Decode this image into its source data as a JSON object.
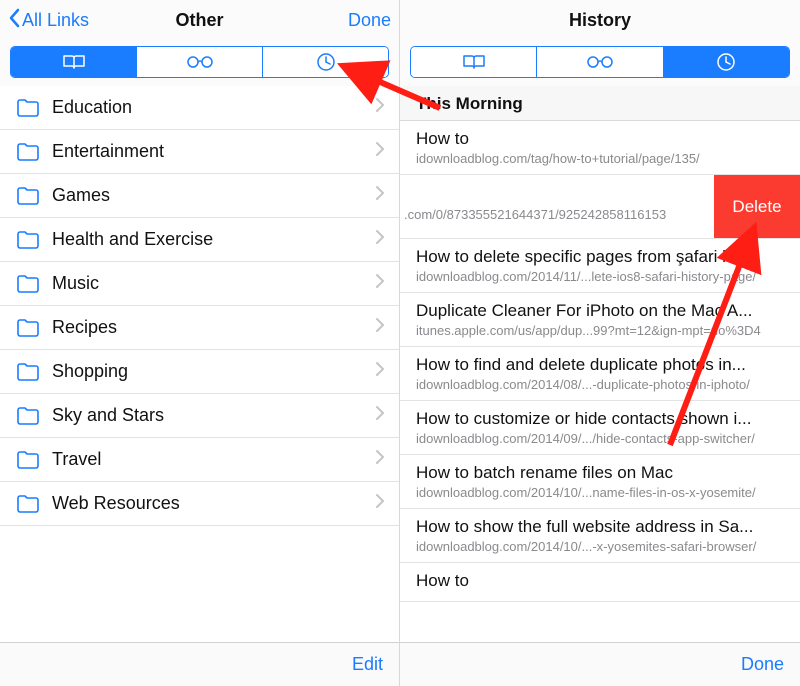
{
  "colors": {
    "tint": "#1a7cff",
    "delete": "#fb3b30"
  },
  "left": {
    "back_label": "All Links",
    "title": "Other",
    "done": "Done",
    "segments": {
      "bookmarks": "bookmarks-icon",
      "readinglist": "glasses-icon",
      "history": "clock-icon",
      "selected": 0
    },
    "folders": [
      {
        "label": "Education"
      },
      {
        "label": "Entertainment"
      },
      {
        "label": "Games"
      },
      {
        "label": "Health and Exercise"
      },
      {
        "label": "Music"
      },
      {
        "label": "Recipes"
      },
      {
        "label": "Shopping"
      },
      {
        "label": "Sky and Stars"
      },
      {
        "label": "Travel"
      },
      {
        "label": "Web Resources"
      }
    ],
    "edit": "Edit"
  },
  "right": {
    "title": "History",
    "segments": {
      "bookmarks": "bookmarks-icon",
      "readinglist": "glasses-icon",
      "history": "clock-icon",
      "selected": 2
    },
    "section_header": "This Morning",
    "delete_label": "Delete",
    "items": [
      {
        "title": "How to",
        "url": "idownloadblog.com/tag/how-to+tutorial/page/135/"
      },
      {
        "title": "",
        "url": ".com/0/873355521644371/925242858116153",
        "swiped": true
      },
      {
        "title": "How to delete specific pages from şafari hi...",
        "url": "idownloadblog.com/2014/11/...lete-ios8-safari-history-page/"
      },
      {
        "title": "Duplicate Cleaner For iPhoto on the Mac A...",
        "url": "itunes.apple.com/us/app/dup...99?mt=12&ign-mpt=uo%3D4"
      },
      {
        "title": "How to find and delete duplicate photos in...",
        "url": "idownloadblog.com/2014/08/...-duplicate-photos-in-iphoto/"
      },
      {
        "title": "How to customize or hide contacts shown i...",
        "url": "idownloadblog.com/2014/09/.../hide-contacts-app-switcher/"
      },
      {
        "title": "How to batch rename files on Mac",
        "url": "idownloadblog.com/2014/10/...name-files-in-os-x-yosemite/"
      },
      {
        "title": "How to show the full website address in Sa...",
        "url": "idownloadblog.com/2014/10/...-x-yosemites-safari-browser/"
      },
      {
        "title": "How to",
        "url": ""
      }
    ],
    "done": "Done"
  }
}
